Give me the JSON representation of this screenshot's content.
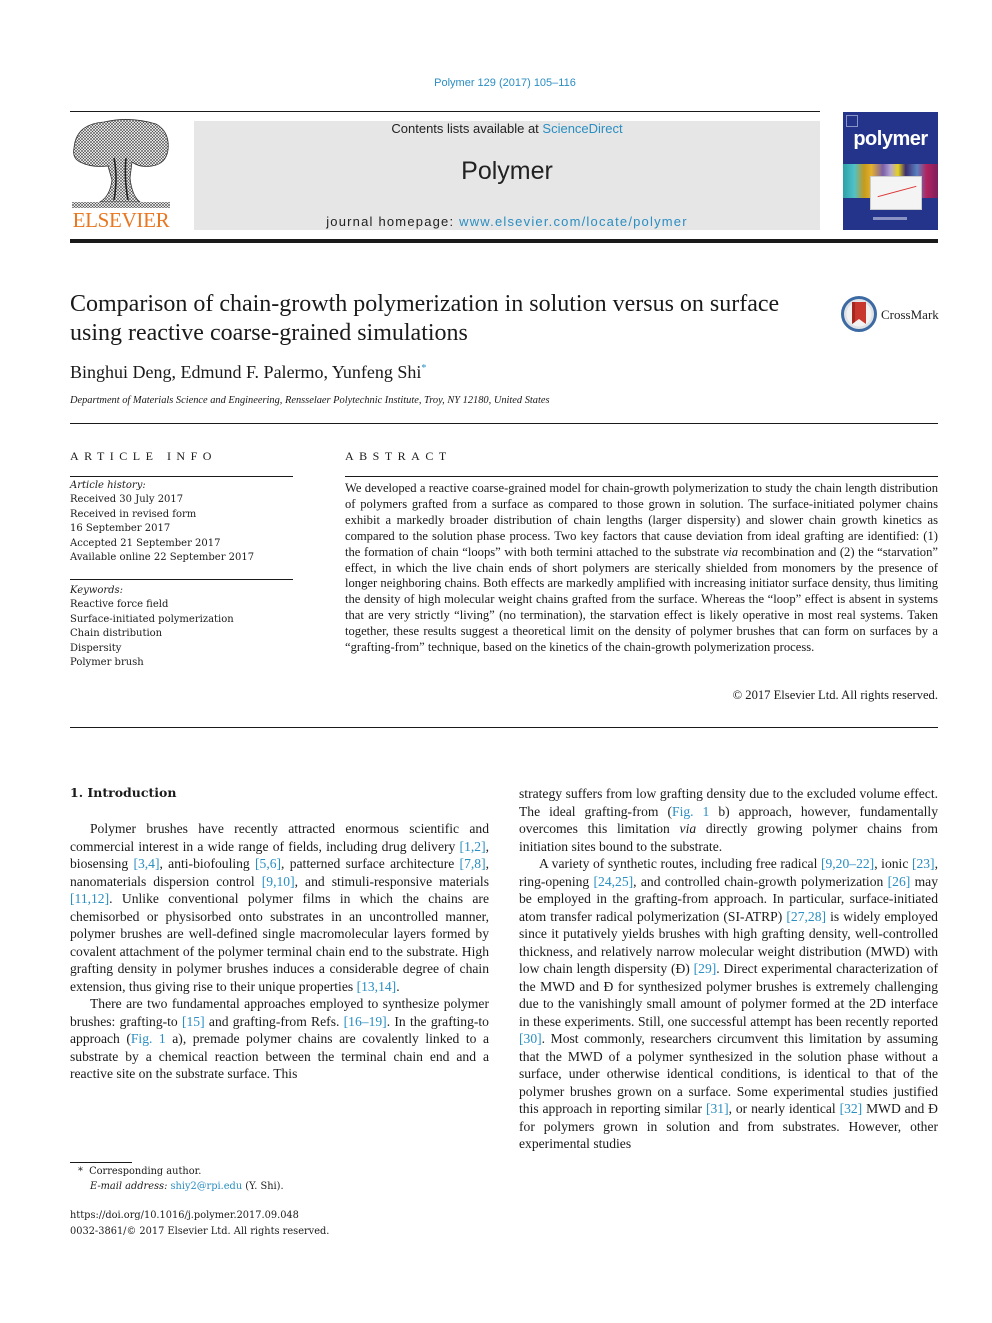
{
  "header": {
    "citation": "Polymer 129 (2017) 105–116",
    "publisher_logo_text": "ELSEVIER",
    "contents_prefix": "Contents lists available at ",
    "contents_link": "ScienceDirect",
    "journal_name": "Polymer",
    "homepage_prefix": "journal homepage: ",
    "homepage_link": "www.elsevier.com/locate/polymer",
    "cover_title": "polymer",
    "crossmark_label": "CrossMark"
  },
  "article": {
    "title": "Comparison of chain-growth polymerization in solution versus on surface using reactive coarse-grained simulations",
    "authors": "Binghui Deng, Edmund F. Palermo, Yunfeng Shi",
    "author_mark": "*",
    "affiliation": "Department of Materials Science and Engineering, Rensselaer Polytechnic Institute, Troy, NY 12180, United States"
  },
  "article_info": {
    "heading": "ARTICLE INFO",
    "history_label": "Article history:",
    "history": [
      "Received 30 July 2017",
      "Received in revised form",
      "16 September 2017",
      "Accepted 21 September 2017",
      "Available online 22 September 2017"
    ],
    "keywords_label": "Keywords:",
    "keywords": [
      "Reactive force field",
      "Surface-initiated polymerization",
      "Chain distribution",
      "Dispersity",
      "Polymer brush"
    ]
  },
  "abstract": {
    "heading": "ABSTRACT",
    "text_1": "We developed a reactive coarse-grained model for chain-growth polymerization to study the chain length distribution of polymers grafted from a surface as compared to those grown in solution. The surface-initiated polymer chains exhibit a markedly broader distribution of chain lengths (larger dis­persity) and slower chain growth kinetics as compared to the solution phase process. Two key factors that cause deviation from ideal grafting are identified: (1) the formation of chain “loops” with both termini attached to the substrate ",
    "text_via": "via",
    "text_2": " recombination and (2) the “starvation” effect, in which the live chain ends of short polymers are sterically shielded from monomers by the presence of longer neigh­boring chains. Both effects are markedly amplified with increasing initiator surface density, thus limiting the density of high molecular weight chains grafted from the surface. Whereas the “loop” effect is absent in systems that are very strictly “living” (no termination), the starvation effect is likely operative in most real systems. Taken together, these results suggest a theoretical limit on the density of polymer brushes that can form on surfaces by a “grafting-from” technique, based on the kinetics of the chain-growth polymerization process.",
    "copyright": "© 2017 Elsevier Ltd. All rights reserved."
  },
  "introduction": {
    "heading": "1.  Introduction",
    "p1": [
      {
        "t": "Polymer brushes have recently attracted enormous scientific and commercial interest in a wide range of fields, including drug delivery "
      },
      {
        "ref": "[1,2]"
      },
      {
        "t": ", biosensing "
      },
      {
        "ref": "[3,4]"
      },
      {
        "t": ", anti-biofouling "
      },
      {
        "ref": "[5,6]"
      },
      {
        "t": ", patterned surface architecture "
      },
      {
        "ref": "[7,8]"
      },
      {
        "t": ", nanomaterials dispersion control "
      },
      {
        "ref": "[9,10]"
      },
      {
        "t": ", and stimuli-responsive materials "
      },
      {
        "ref": "[11,12]"
      },
      {
        "t": ". Unlike conventional polymer films in which the chains are chemisorbed or physisorbed onto substrates in an uncontrolled manner, polymer brushes are well-defined single macromolecular layers formed by covalent attachment of the polymer terminal chain end to the substrate. High grafting density in polymer brushes induces a considerable degree of chain extension, thus giving rise to their unique proper­ties "
      },
      {
        "ref": "[13,14]"
      },
      {
        "t": "."
      }
    ],
    "p2": [
      {
        "t": "There are two fundamental approaches employed to synthesize polymer brushes: grafting-to "
      },
      {
        "ref": "[15]"
      },
      {
        "t": " and grafting-from Refs. "
      },
      {
        "ref": "[16–19]"
      },
      {
        "t": ". In the grafting-to approach ("
      },
      {
        "ref": "Fig. 1"
      },
      {
        "t": " a), premade polymer chains are covalently linked to a substrate by a chemical reaction between the terminal chain end and a reactive site on the substrate surface. This "
      }
    ],
    "p2_cont": [
      {
        "t": "strategy suffers from low grafting density due to the excluded volume effect. The ideal grafting-from ("
      },
      {
        "ref": "Fig. 1"
      },
      {
        "t": " b) approach, however, fundamentally overcomes this limitation "
      },
      {
        "i": "via"
      },
      {
        "t": " directly growing polymer chains from initiation sites bound to the substrate."
      }
    ],
    "p3": [
      {
        "t": "A variety of synthetic routes, including free radical "
      },
      {
        "ref": "[9,20–22]"
      },
      {
        "t": ", ionic "
      },
      {
        "ref": "[23]"
      },
      {
        "t": ", ring-opening "
      },
      {
        "ref": "[24,25]"
      },
      {
        "t": ", and controlled chain-growth polymerization "
      },
      {
        "ref": "[26]"
      },
      {
        "t": " may be employed in the grafting-from approach. In particular, surface-initiated atom transfer radical polymerization (SI-ATRP) "
      },
      {
        "ref": "[27,28]"
      },
      {
        "t": " is widely employed since it pu­tatively yields brushes with high grafting density, well-controlled thickness, and relatively narrow molecular weight distribution (MWD) with low chain length dispersity (Đ) "
      },
      {
        "ref": "[29]"
      },
      {
        "t": ". Direct experi­mental characterization of the MWD and Đ for synthesized poly­mer brushes is extremely challenging due to the vanishingly small amount of polymer formed at the 2D interface in these experi­ments. Still, one successful attempt has been recently reported "
      },
      {
        "ref": "[30]"
      },
      {
        "t": ". Most commonly, researchers circumvent this limitation by assuming that the MWD of a polymer synthesized in the solution phase without a surface, under otherwise identical conditions, is identical to that of the polymer brushes grown on a surface. Some experimental studies justified this approach in reporting similar "
      },
      {
        "ref": "[31]"
      },
      {
        "t": ", or nearly identical "
      },
      {
        "ref": "[32]"
      },
      {
        "t": " MWD and Đ for polymers grown in solution and from substrates. However, other experimental studies"
      }
    ]
  },
  "footnotes": {
    "corresponding_mark": "*",
    "corresponding_text": "Corresponding author.",
    "email_label": "E-mail address:",
    "email": "shiy2@rpi.edu",
    "email_suffix": " (Y. Shi).",
    "doi": "https://doi.org/10.1016/j.polymer.2017.09.048",
    "issn_copyright": "0032-3861/© 2017 Elsevier Ltd. All rights reserved."
  },
  "colors": {
    "link": "#2a8ec2",
    "elsevier_orange": "#e87722",
    "cover_blue": "#24348a",
    "journal_box_gray": "#e6e6e6"
  }
}
